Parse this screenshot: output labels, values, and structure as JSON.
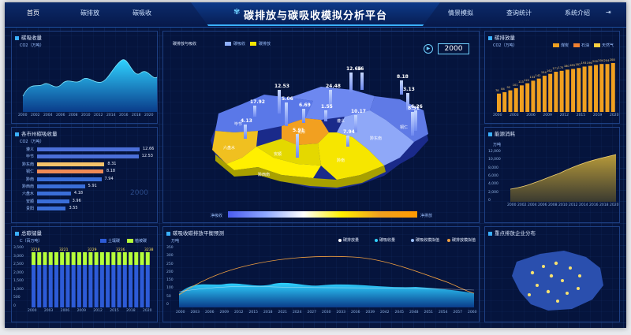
{
  "nav": {
    "home": "首页",
    "emission": "碳排放",
    "absorb": "碳吸收",
    "title": "碳排放与碳吸收模拟分析平台",
    "scenario": "情景模拟",
    "query": "查询统计",
    "about": "系统介绍"
  },
  "colors": {
    "bg": "#06153e",
    "accent": "#3ab0ff",
    "orange": "#f0a020",
    "yellow": "#f6e600",
    "lime": "#b6ff3a",
    "blue": "#2d5bd7"
  },
  "panels": {
    "tl": {
      "title": "碳吸收量",
      "unit": "CO2（万吨）",
      "xticks": [
        "2000",
        "2002",
        "2004",
        "2006",
        "2008",
        "2010",
        "2012",
        "2014",
        "2016",
        "2018",
        "2020"
      ]
    },
    "ml": {
      "title": "各市州碳吸收量",
      "unit": "CO2（万吨）",
      "year": "2000",
      "items": [
        {
          "name": "遵义",
          "value": "12.66"
        },
        {
          "name": "毕节",
          "value": "12.53"
        },
        {
          "name": "黔东南",
          "value": "8.31"
        },
        {
          "name": "铜仁",
          "value": "8.18"
        },
        {
          "name": "黔南",
          "value": "7.94"
        },
        {
          "name": "黔西南",
          "value": "5.91"
        },
        {
          "name": "六盘水",
          "value": "4.18"
        },
        {
          "name": "安顺",
          "value": "3.96"
        },
        {
          "name": "贵阳",
          "value": "3.55"
        }
      ]
    },
    "bl": {
      "title": "总碳储量",
      "unit": "C（百万吨）",
      "legend": [
        "土壤碳",
        "植被碳"
      ],
      "yticks": [
        "3,500",
        "3,000",
        "2,500",
        "2,000",
        "1,500",
        "1,000",
        "500",
        "0"
      ],
      "xticks": [
        "2000",
        "2003",
        "2006",
        "2009",
        "2012",
        "2015",
        "2018",
        "2020"
      ],
      "toplabels": [
        "3218",
        "3221",
        "3229",
        "3236",
        "3238"
      ]
    },
    "map": {
      "title": "碳排放与吸收",
      "legend": [
        "碳吸收",
        "碳排放"
      ],
      "year": "2000",
      "low": "净吸收",
      "high": "净排放",
      "labels": [
        {
          "v": "12.53"
        },
        {
          "v": "12.66"
        },
        {
          "v": "16"
        },
        {
          "v": "8.18"
        },
        {
          "v": "17.92"
        },
        {
          "v": "5.06"
        },
        {
          "v": "24.48"
        },
        {
          "v": "3.13"
        },
        {
          "v": "6.69"
        },
        {
          "v": "1.55"
        },
        {
          "v": "8.31"
        },
        {
          "v": "6.26"
        },
        {
          "v": "10.17"
        },
        {
          "v": "4.13"
        },
        {
          "v": "7.94"
        },
        {
          "v": "5.91"
        }
      ],
      "regions": [
        "毕节",
        "遵义",
        "铜仁",
        "六盘水",
        "贵阳",
        "黔东南",
        "黔南",
        "安顺",
        "黔西南"
      ]
    },
    "bottom": {
      "title": "碳吸收碳排放平衡预测",
      "unit": "万吨",
      "legend": [
        "碳排放量",
        "碳吸收量",
        "碳吸收模拟值",
        "碳排放模拟值"
      ],
      "yticks": [
        "350",
        "300",
        "250",
        "200",
        "150",
        "100",
        "50",
        "0"
      ],
      "xticks": [
        "2000",
        "2003",
        "2006",
        "2009",
        "2012",
        "2015",
        "2018",
        "2021",
        "2024",
        "2027",
        "2030",
        "2033",
        "2036",
        "2039",
        "2042",
        "2045",
        "2048",
        "2051",
        "2054",
        "2057",
        "2060"
      ]
    },
    "tr": {
      "title": "碳排放量",
      "unit": "CO2（万吨）",
      "legend": [
        "煤炭",
        "石油",
        "天然气"
      ],
      "xticks": [
        "2000",
        "2003",
        "2006",
        "2009",
        "2012",
        "2015",
        "2019",
        "2020"
      ],
      "vals": [
        "78",
        "84",
        "92",
        "101",
        "113",
        "122",
        "133",
        "142",
        "154",
        "162",
        "171",
        "175",
        "180",
        "183",
        "187",
        "193",
        "196",
        "200",
        "204",
        "204",
        "208"
      ]
    },
    "mr": {
      "title": "能源消耗",
      "unit": "万吨",
      "yticks": [
        "12,000",
        "10,000",
        "8,000",
        "6,000",
        "4,000",
        "2,000",
        "0"
      ],
      "xticks": [
        "2000",
        "2002",
        "2004",
        "2006",
        "2008",
        "2010",
        "2012",
        "2014",
        "2016",
        "2018",
        "2020"
      ]
    },
    "br": {
      "title": "重点排放企业分布"
    }
  }
}
